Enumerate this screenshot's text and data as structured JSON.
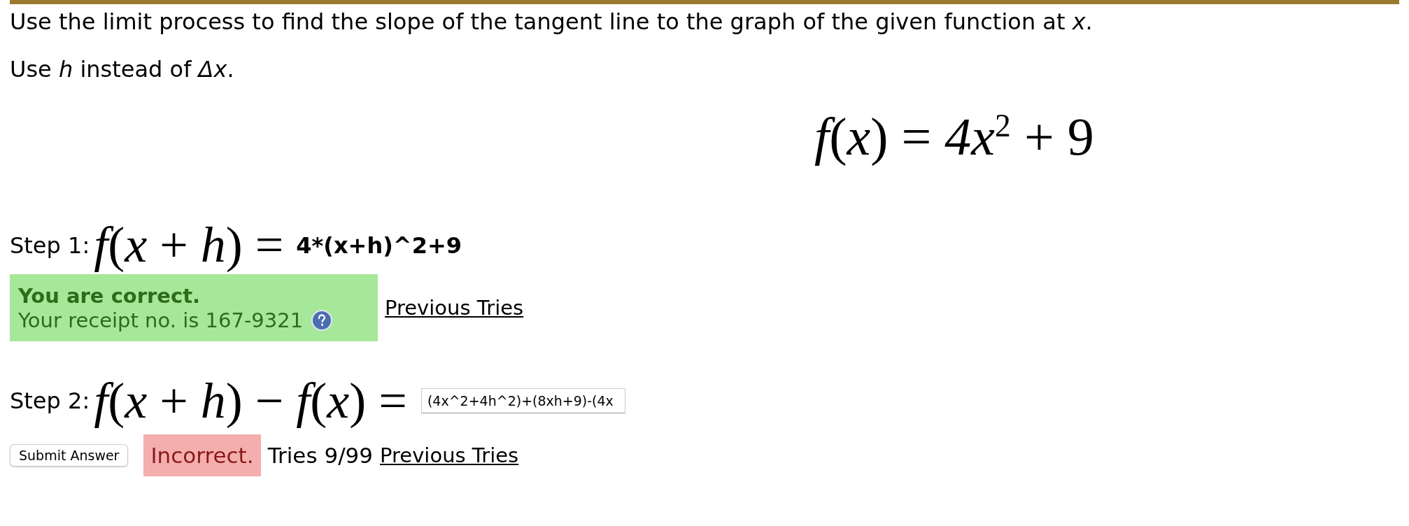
{
  "instructions": [
    "Use the limit process to find the slope of the tangent line to the graph of the given function at *x*.",
    "Use *h* instead of *Δx*."
  ],
  "function": "*f*(*x*) = *4x*$^{2}$ + 9",
  "steps": [
    {
      "label": "Step 1:",
      "formula": "*f*(*x* + *h*) =",
      "kind": "answered",
      "answer": "4*(x+h)^2+9",
      "feedback": {
        "kind": "correct",
        "title": "You are correct.",
        "message": "Your receipt no. is 167-9321"
      },
      "link": "Previous Tries"
    },
    {
      "label": "Step 2:",
      "formula": "*f*(*x* + *h*) − *f*(*x*) =",
      "kind": "input",
      "answer": "(4x^2+4h^2)+(8xh+9)-(4x",
      "button": "Submit Answer",
      "feedback": {
        "kind": "incorrect",
        "title": "Incorrect."
      },
      "tries": "Tries 9/99",
      "link": "Previous Tries"
    }
  ]
}
